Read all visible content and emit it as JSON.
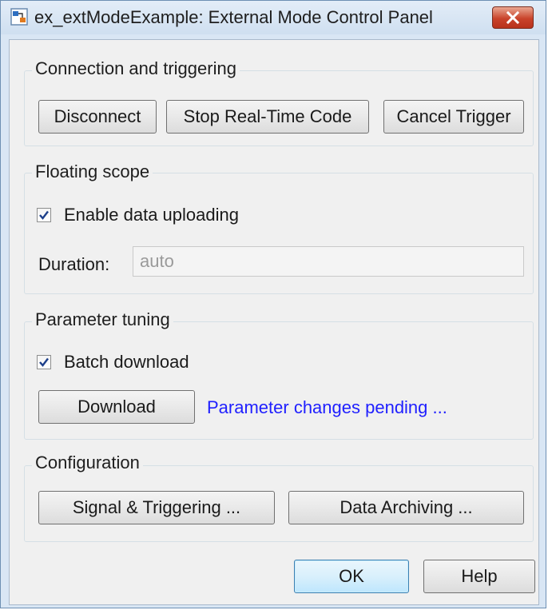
{
  "window": {
    "title": "ex_extModeExample: External Mode Control Panel",
    "app_icon": "simulink-model-icon",
    "close_icon": "close-icon"
  },
  "connection": {
    "group_title": "Connection and triggering",
    "disconnect_label": "Disconnect",
    "stop_label": "Stop Real-Time Code",
    "cancel_trigger_label": "Cancel Trigger"
  },
  "floating_scope": {
    "group_title": "Floating scope",
    "enable_upload_label": "Enable data uploading",
    "enable_upload_checked": true,
    "duration_label": "Duration:",
    "duration_value": "auto"
  },
  "parameter_tuning": {
    "group_title": "Parameter tuning",
    "batch_download_label": "Batch download",
    "batch_download_checked": true,
    "download_label": "Download",
    "pending_text": "Parameter changes pending ...",
    "pending_color": "#1f1fff"
  },
  "configuration": {
    "group_title": "Configuration",
    "signal_triggering_label": "Signal & Triggering ...",
    "data_archiving_label": "Data Archiving ..."
  },
  "footer": {
    "ok_label": "OK",
    "help_label": "Help"
  }
}
